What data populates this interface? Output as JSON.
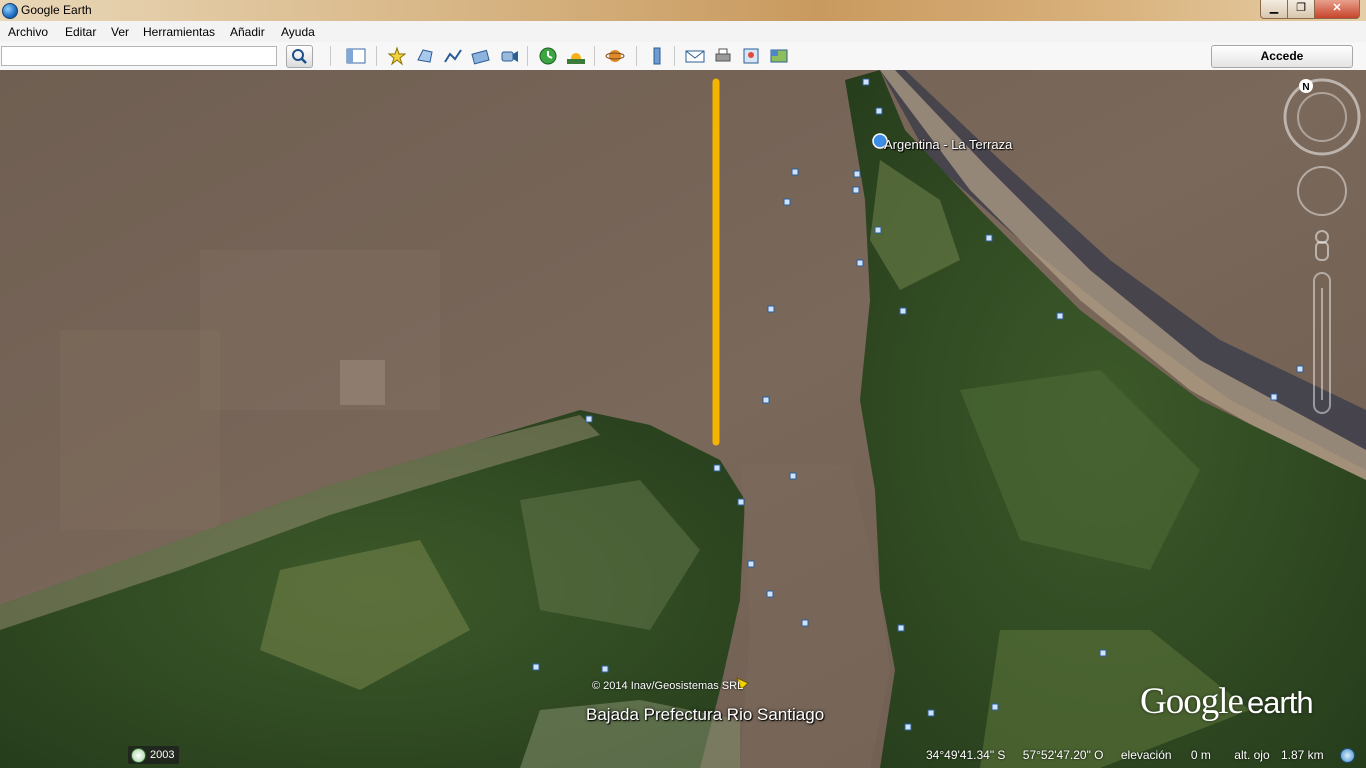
{
  "window": {
    "title": "Google Earth"
  },
  "menu": [
    "Archivo",
    "Editar",
    "Ver",
    "Herramientas",
    "Añadir",
    "Ayuda"
  ],
  "toolbar": {
    "search_value": "",
    "account_button": "Accede",
    "icons": [
      "sidebar-toggle-icon",
      "placemark-add-icon",
      "polygon-add-icon",
      "path-add-icon",
      "overlay-add-icon",
      "tour-record-icon",
      "historical-imagery-icon",
      "sunlight-icon",
      "planets-icon",
      "ruler-icon",
      "email-icon",
      "print-icon",
      "save-image-icon",
      "view-maps-icon"
    ]
  },
  "map": {
    "placemark_label": "Argentina - La Terraza",
    "place_label": "Bajada Prefectura Rio Santiago",
    "copyright": "© 2014 Inav/Geosistemas SRL",
    "logo_google": "Google",
    "logo_earth": "earth",
    "compass_north": "N",
    "path_color": "#f5b400"
  },
  "status": {
    "imagery_year": "2003",
    "latitude": "34°49'41.34\" S",
    "longitude": "57°52'47.20\" O",
    "elevation_label": "elevación",
    "elevation_value": "0 m",
    "eye_alt_label": "alt. ojo",
    "eye_alt_value": "1.87 km"
  }
}
